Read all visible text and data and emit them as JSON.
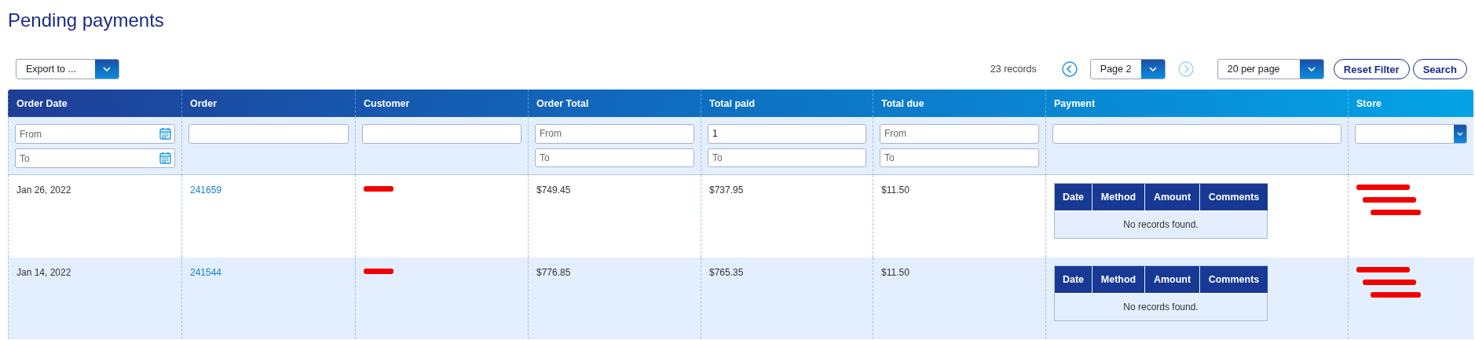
{
  "page_title": "Pending payments",
  "toolbar": {
    "export": "Export to ...",
    "records": "23 records",
    "prev_disabled": false,
    "page": "Page 2",
    "next_disabled": true,
    "per_page": "20 per page",
    "reset": "Reset Filter",
    "search": "Search"
  },
  "columns": [
    {
      "label": "Order Date",
      "filter": {
        "kind": "date_range",
        "fields": [
          {
            "placeholder": "From"
          },
          {
            "placeholder": "To"
          }
        ]
      }
    },
    {
      "label": "Order",
      "filter": {
        "kind": "text"
      }
    },
    {
      "label": "Customer",
      "filter": {
        "kind": "text"
      }
    },
    {
      "label": "Order Total",
      "filter": {
        "kind": "range",
        "fields": [
          {
            "placeholder": "From"
          },
          {
            "placeholder": "To"
          }
        ]
      }
    },
    {
      "label": "Total paid",
      "filter": {
        "kind": "range",
        "fields": [
          {
            "value": "1"
          },
          {
            "placeholder": "To"
          }
        ]
      }
    },
    {
      "label": "Total due",
      "filter": {
        "kind": "range",
        "fields": [
          {
            "placeholder": "From"
          },
          {
            "placeholder": "To"
          }
        ]
      }
    },
    {
      "label": "Payment",
      "filter": {
        "kind": "text"
      }
    },
    {
      "label": "Store",
      "filter": {
        "kind": "select"
      }
    }
  ],
  "rows": [
    {
      "order_date": "Jan 26, 2022",
      "order": "241659",
      "order_total": "$749.45",
      "total_paid": "$737.95",
      "total_due": "$11.50",
      "payments": {
        "columns": [
          "Date",
          "Method",
          "Amount",
          "Comments"
        ],
        "empty": "No records found."
      }
    },
    {
      "order_date": "Jan 14, 2022",
      "order": "241544",
      "order_total": "$776.85",
      "total_paid": "$765.35",
      "total_due": "$11.50",
      "payments": {
        "columns": [
          "Date",
          "Method",
          "Amount",
          "Comments"
        ],
        "empty": "No records found."
      }
    }
  ]
}
